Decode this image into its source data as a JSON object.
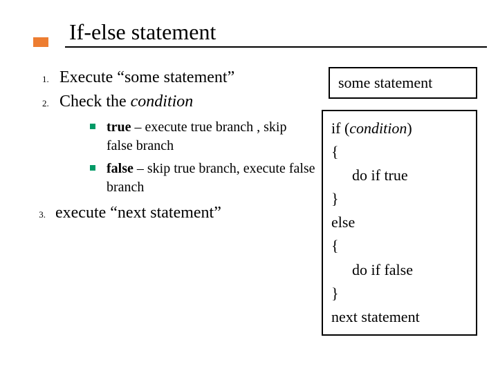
{
  "title": "If-else statement",
  "code_top": "some statement",
  "steps": {
    "s1": "Execute “some statement”",
    "s2_pre": "Check the ",
    "s2_it": "condition",
    "sub1_b": "true",
    "sub1_rest": " – execute true branch , skip false branch",
    "sub2_b": "false",
    "sub2_rest": " – skip true branch, execute false branch",
    "s3": "execute “next statement”",
    "s3_marker": "3."
  },
  "code": {
    "l1_pre": "if (",
    "l1_it": "condition",
    "l1_post": ")",
    "l2": "{",
    "l3": "do if true",
    "l4": "}",
    "l5": "else",
    "l6": "{",
    "l7": "do if false",
    "l8": "}",
    "l9": "next statement"
  }
}
